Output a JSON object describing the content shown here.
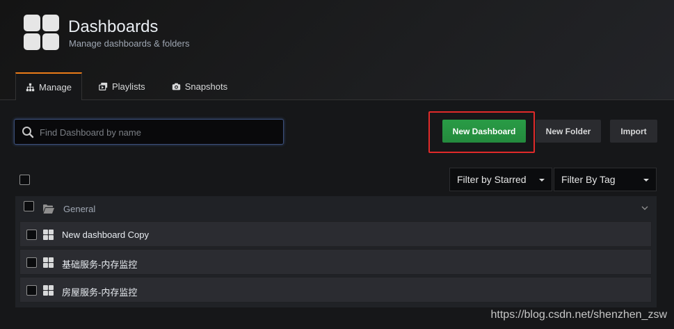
{
  "header": {
    "title": "Dashboards",
    "subtitle": "Manage dashboards & folders"
  },
  "tabs": [
    {
      "label": "Manage",
      "icon": "sitemap-icon",
      "active": true
    },
    {
      "label": "Playlists",
      "icon": "playlist-icon",
      "active": false
    },
    {
      "label": "Snapshots",
      "icon": "camera-icon",
      "active": false
    }
  ],
  "search": {
    "placeholder": "Find Dashboard by name",
    "value": ""
  },
  "actions": {
    "new_dashboard": "New Dashboard",
    "new_folder": "New Folder",
    "import": "Import"
  },
  "filters": {
    "starred": "Filter by Starred",
    "tag": "Filter By Tag"
  },
  "folder": {
    "name": "General",
    "dashboards": [
      {
        "title": "New dashboard Copy"
      },
      {
        "title": "基础服务-内存监控"
      },
      {
        "title": "房屋服务-内存监控"
      }
    ]
  },
  "watermark": "https://blog.csdn.net/shenzhen_zsw",
  "colors": {
    "accent_tab": "#eb7b18",
    "primary_button": "#299c46",
    "highlight": "#e02a2a",
    "background": "#161719"
  }
}
